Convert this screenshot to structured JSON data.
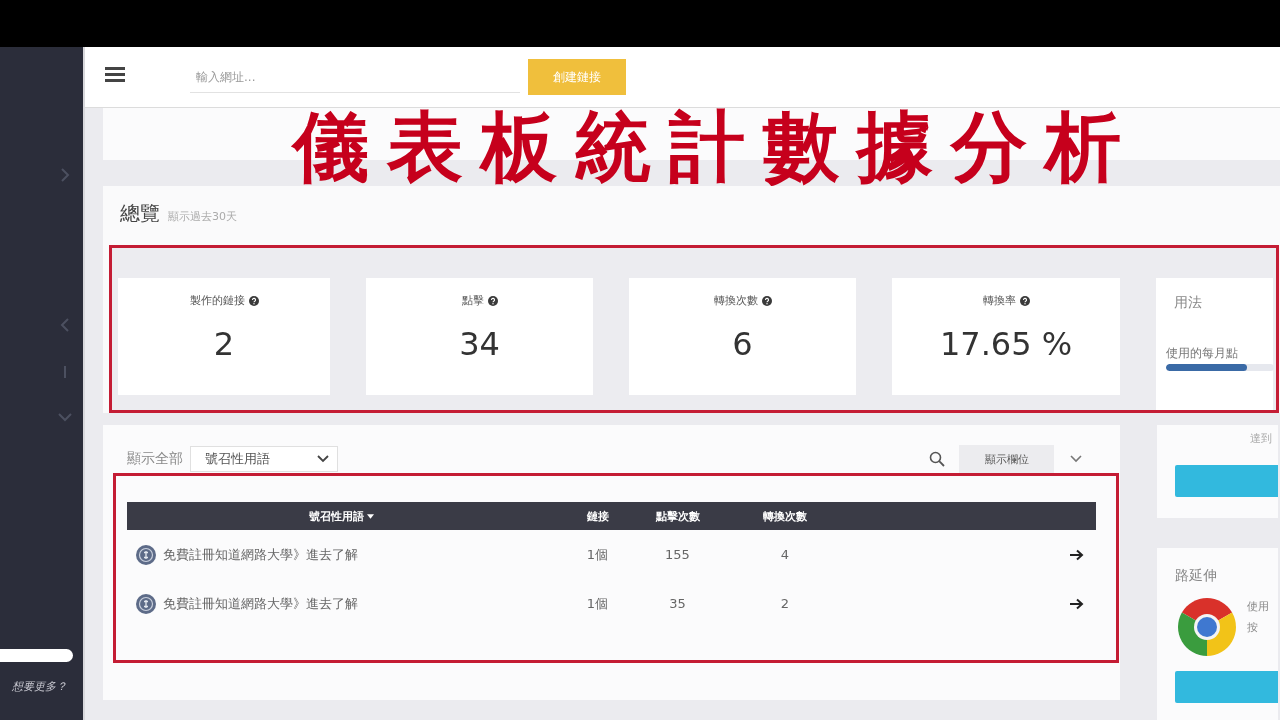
{
  "sidebar": {
    "footer_link": "想要更多？"
  },
  "topbar": {
    "search": {
      "placeholder": "輸入網址..."
    },
    "create_button": "創建鏈接"
  },
  "caption": "儀表板統計數據分析",
  "overview": {
    "title": "總覽",
    "subtitle": "顯示過去30天",
    "highlighted": true,
    "stats": [
      {
        "label": "製作的鏈接",
        "value": "2"
      },
      {
        "label": "點擊",
        "value": "34"
      },
      {
        "label": "轉換次數",
        "value": "6"
      },
      {
        "label": "轉換率",
        "value": "17.65 %"
      }
    ],
    "usage": {
      "title": "用法",
      "meter_label": "使用的每月點",
      "level": 0.75
    }
  },
  "table_panel": {
    "highlighted": true,
    "filter_label": "顯示全部",
    "filter_value": "號召性用語",
    "columns_button": "顯示欄位",
    "columns": [
      {
        "label": "號召性用語",
        "sorted": true
      },
      {
        "label": "鏈接",
        "sorted": false
      },
      {
        "label": "點擊次數",
        "sorted": false
      },
      {
        "label": "轉換次數",
        "sorted": false
      }
    ],
    "rows": [
      {
        "cells": [
          "免費註冊知道網路大學》進去了解",
          "1個",
          "155",
          "4"
        ]
      },
      {
        "cells": [
          "免費註冊知道網路大學》進去了解",
          "1個",
          "35",
          "2"
        ]
      }
    ]
  },
  "upgrade_card": {
    "note": "達到"
  },
  "extension_card": {
    "title": "路延伸",
    "text_lines": [
      "使用",
      "按"
    ]
  }
}
